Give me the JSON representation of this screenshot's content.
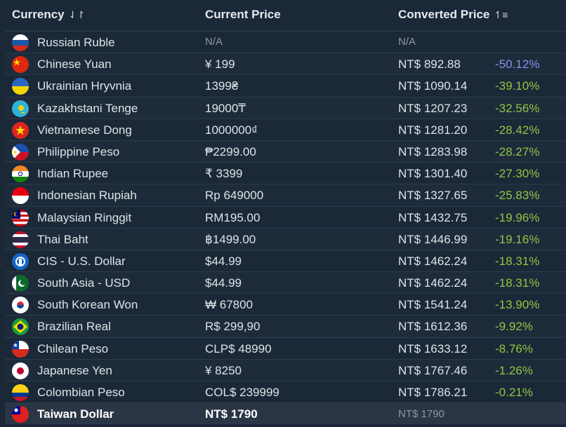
{
  "header": {
    "currency_label": "Currency",
    "current_price_label": "Current Price",
    "converted_price_label": "Converted Price",
    "currency_sort_icon": "sort-arrows-icon",
    "converted_sort_icon": "sort-ascending-icon"
  },
  "rows": [
    {
      "name": "Russian Ruble",
      "price": "N/A",
      "converted": "N/A",
      "pct": "",
      "flag": "russia-flag-icon"
    },
    {
      "name": "Chinese Yuan",
      "price": "¥ 199",
      "converted": "NT$ 892.88",
      "pct": "-50.12%",
      "flag": "china-flag-icon"
    },
    {
      "name": "Ukrainian Hryvnia",
      "price": "1399₴",
      "converted": "NT$ 1090.14",
      "pct": "-39.10%",
      "flag": "ukraine-flag-icon"
    },
    {
      "name": "Kazakhstani Tenge",
      "price": "19000₸",
      "converted": "NT$ 1207.23",
      "pct": "-32.56%",
      "flag": "kazakhstan-flag-icon"
    },
    {
      "name": "Vietnamese Dong",
      "price": "1000000₫",
      "converted": "NT$ 1281.20",
      "pct": "-28.42%",
      "flag": "vietnam-flag-icon"
    },
    {
      "name": "Philippine Peso",
      "price": "₱2299.00",
      "converted": "NT$ 1283.98",
      "pct": "-28.27%",
      "flag": "philippines-flag-icon"
    },
    {
      "name": "Indian Rupee",
      "price": "₹ 3399",
      "converted": "NT$ 1301.40",
      "pct": "-27.30%",
      "flag": "india-flag-icon"
    },
    {
      "name": "Indonesian Rupiah",
      "price": "Rp 649000",
      "converted": "NT$ 1327.65",
      "pct": "-25.83%",
      "flag": "indonesia-flag-icon"
    },
    {
      "name": "Malaysian Ringgit",
      "price": "RM195.00",
      "converted": "NT$ 1432.75",
      "pct": "-19.96%",
      "flag": "malaysia-flag-icon"
    },
    {
      "name": "Thai Baht",
      "price": "฿1499.00",
      "converted": "NT$ 1446.99",
      "pct": "-19.16%",
      "flag": "thailand-flag-icon"
    },
    {
      "name": "CIS - U.S. Dollar",
      "price": "$44.99",
      "converted": "NT$ 1462.24",
      "pct": "-18.31%",
      "flag": "cis-flag-icon"
    },
    {
      "name": "South Asia - USD",
      "price": "$44.99",
      "converted": "NT$ 1462.24",
      "pct": "-18.31%",
      "flag": "south-asia-flag-icon"
    },
    {
      "name": "South Korean Won",
      "price": "₩ 67800",
      "converted": "NT$ 1541.24",
      "pct": "-13.90%",
      "flag": "south-korea-flag-icon"
    },
    {
      "name": "Brazilian Real",
      "price": "R$ 299,90",
      "converted": "NT$ 1612.36",
      "pct": "-9.92%",
      "flag": "brazil-flag-icon"
    },
    {
      "name": "Chilean Peso",
      "price": "CLP$ 48990",
      "converted": "NT$ 1633.12",
      "pct": "-8.76%",
      "flag": "chile-flag-icon"
    },
    {
      "name": "Japanese Yen",
      "price": "¥ 8250",
      "converted": "NT$ 1767.46",
      "pct": "-1.26%",
      "flag": "japan-flag-icon"
    },
    {
      "name": "Colombian Peso",
      "price": "COL$ 239999",
      "converted": "NT$ 1786.21",
      "pct": "-0.21%",
      "flag": "colombia-flag-icon"
    },
    {
      "name": "Taiwan Dollar",
      "price": "NT$ 1790",
      "converted": "NT$ 1790",
      "pct": "",
      "flag": "taiwan-flag-icon"
    }
  ],
  "colors": {
    "background": "#1b2838",
    "negative_pct": "#8fc741",
    "highlight_pct": "#8a8ff0",
    "muted": "#8f98a0"
  }
}
